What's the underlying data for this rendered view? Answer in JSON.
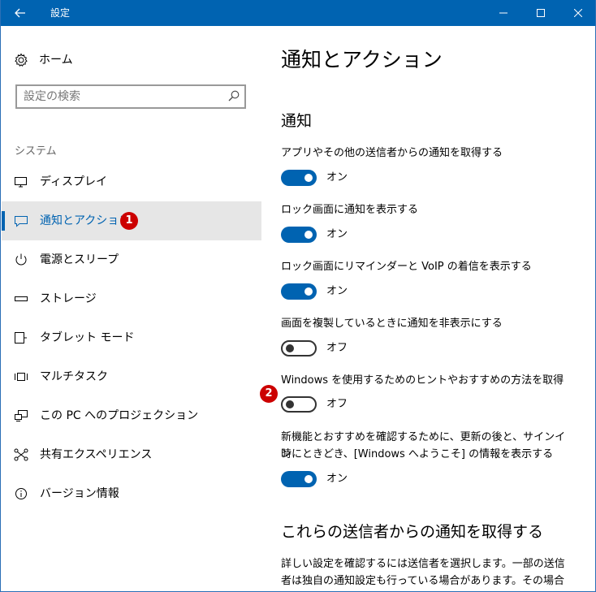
{
  "window": {
    "title": "設定",
    "accent": "#0063b1"
  },
  "sidebar": {
    "home_label": "ホーム",
    "search_placeholder": "設定の検索",
    "section": "システム",
    "items": [
      {
        "label": "ディスプレイ",
        "icon": "monitor-icon"
      },
      {
        "label": "通知とアクション",
        "icon": "notification-icon",
        "active": true
      },
      {
        "label": "電源とスリープ",
        "icon": "power-icon"
      },
      {
        "label": "ストレージ",
        "icon": "storage-icon"
      },
      {
        "label": "タブレット モード",
        "icon": "tablet-icon"
      },
      {
        "label": "マルチタスク",
        "icon": "multitask-icon"
      },
      {
        "label": "この PC へのプロジェクション",
        "icon": "projection-icon"
      },
      {
        "label": "共有エクスペリエンス",
        "icon": "share-icon"
      },
      {
        "label": "バージョン情報",
        "icon": "info-icon"
      }
    ]
  },
  "badges": {
    "b1": "1",
    "b2": "2"
  },
  "main": {
    "title": "通知とアクション",
    "notifications_heading": "通知",
    "settings": [
      {
        "label": "アプリやその他の送信者からの通知を取得する",
        "state": "オン",
        "on": true
      },
      {
        "label": "ロック画面に通知を表示する",
        "state": "オン",
        "on": true
      },
      {
        "label": "ロック画面にリマインダーと VoIP の着信を表示する",
        "state": "オン",
        "on": true
      },
      {
        "label": "画面を複製しているときに通知を非表示にする",
        "state": "オフ",
        "on": false
      },
      {
        "label": "Windows を使用するためのヒントやおすすめの方法を取得",
        "state": "オフ",
        "on": false
      },
      {
        "label_line1": "新機能とおすすめを確認するために、更新の後と、サインイン",
        "label_line2": "時にときどき、[Windows へようこそ] の情報を表示する",
        "state": "オン",
        "on": true
      }
    ],
    "senders_heading": "これらの送信者からの通知を取得する",
    "senders_desc_line1": "詳しい設定を確認するには送信者を選択します。一部の送信",
    "senders_desc_line2": "者は独自の通知設定も行っている場合があります。その場合"
  }
}
